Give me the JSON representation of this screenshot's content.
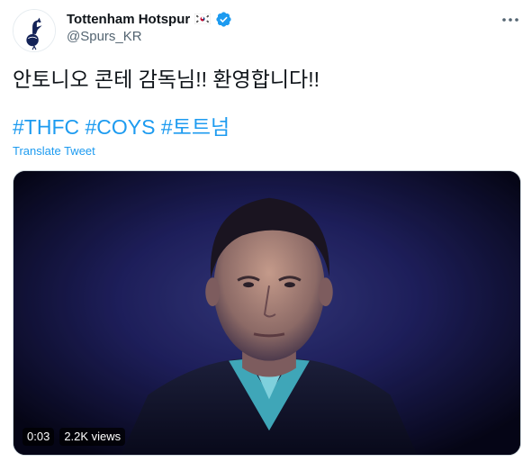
{
  "account": {
    "display_name": "Tottenham Hotspur",
    "handle": "@Spurs_KR",
    "flag_icon": "south-korea-flag-icon",
    "verified_icon": "verified-badge-icon",
    "verified_color": "#1d9bf0"
  },
  "tweet": {
    "text": "안토니오 콘테 감독님!! 환영합니다!!",
    "hashtags": [
      "#THFC",
      "#COYS",
      "#토트넘"
    ],
    "translate_label": "Translate Tweet"
  },
  "media": {
    "type": "video",
    "elapsed": "0:03",
    "views": "2.2K views"
  },
  "colors": {
    "link": "#1d9bf0",
    "text": "#0f1419",
    "secondary": "#536471"
  }
}
